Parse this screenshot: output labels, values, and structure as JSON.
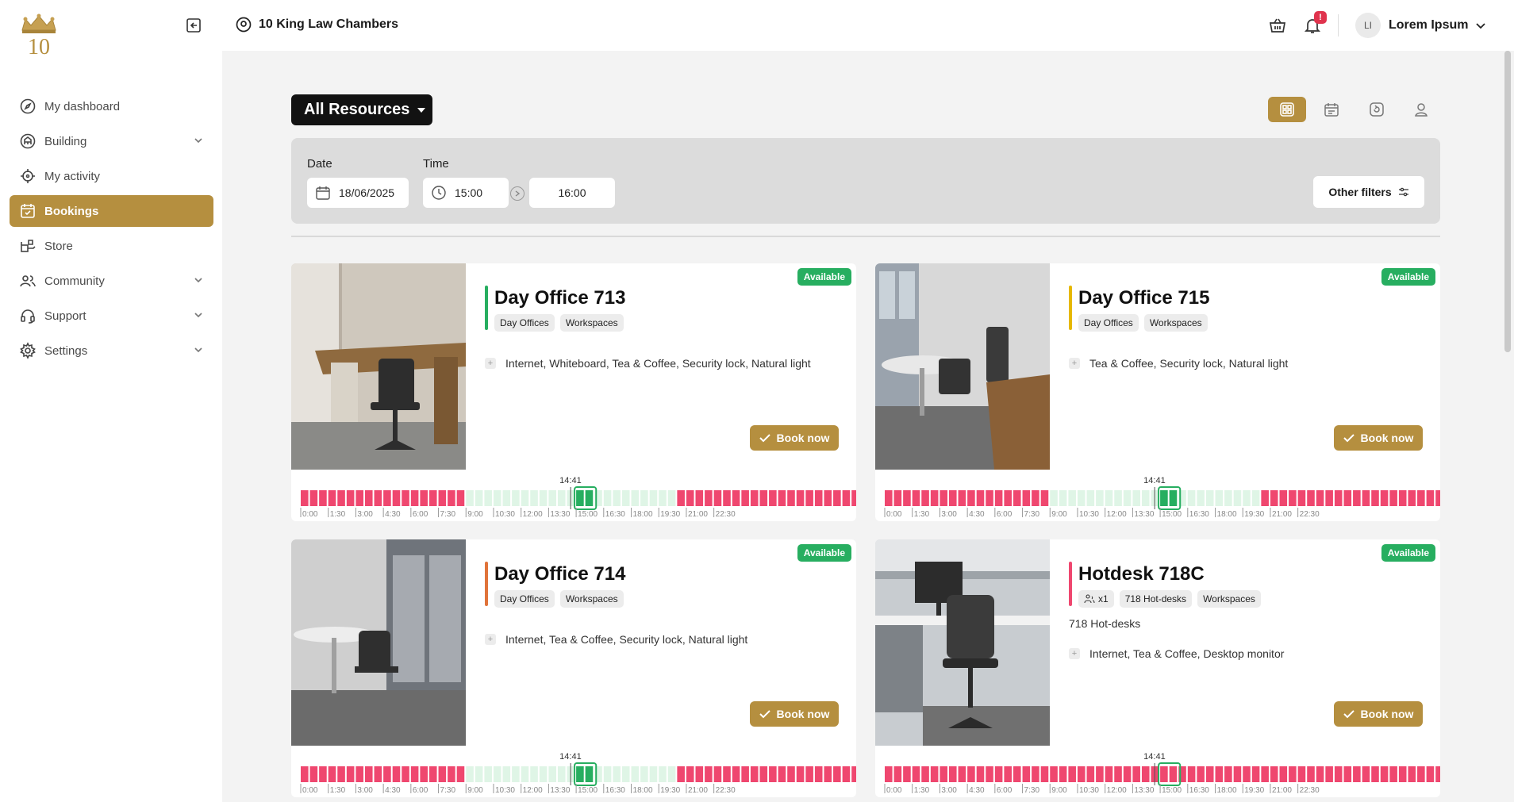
{
  "sidebar": {
    "items": [
      {
        "label": "My dashboard",
        "icon": "compass-icon",
        "has_chevron": false,
        "active": false
      },
      {
        "label": "Building",
        "icon": "building-icon",
        "has_chevron": true,
        "active": false
      },
      {
        "label": "My activity",
        "icon": "crosshair-icon",
        "has_chevron": false,
        "active": false
      },
      {
        "label": "Bookings",
        "icon": "calendar-check-icon",
        "has_chevron": false,
        "active": true
      },
      {
        "label": "Store",
        "icon": "store-icon",
        "has_chevron": false,
        "active": false
      },
      {
        "label": "Community",
        "icon": "users-icon",
        "has_chevron": true,
        "active": false
      },
      {
        "label": "Support",
        "icon": "headset-icon",
        "has_chevron": true,
        "active": false
      },
      {
        "label": "Settings",
        "icon": "gear-icon",
        "has_chevron": true,
        "active": false
      }
    ]
  },
  "header": {
    "location": "10 King Law Chambers",
    "notification_badge": "!",
    "avatar_initials": "LI",
    "user_name": "Lorem Ipsum"
  },
  "toolbar": {
    "resource_filter": "All Resources",
    "views": [
      "grid-view-icon",
      "calendar-view-icon",
      "timeline-view-icon",
      "person-view-icon"
    ],
    "active_view": 0
  },
  "filters": {
    "date_label": "Date",
    "date_value": "18/06/2025",
    "time_label": "Time",
    "time_start": "15:00",
    "time_end": "16:00",
    "other_filters": "Other filters"
  },
  "timeline_ticks": [
    "0:00",
    "1:30",
    "3:00",
    "4:30",
    "6:00",
    "7:30",
    "9:00",
    "10:30",
    "12:00",
    "13:30",
    "15:00",
    "16:30",
    "18:00",
    "19:30",
    "21:00",
    "22:30"
  ],
  "colors": {
    "gold": "#b58f3f",
    "booked": "#ef476f",
    "free": "#dff5e6",
    "selected": "#27ae60",
    "available_badge": "#27ae60"
  },
  "cards": [
    {
      "title": "Day Office 713",
      "accent": "#27ae60",
      "tags": [
        "Day Offices",
        "Workspaces"
      ],
      "seat_tag": "",
      "subtitle": "",
      "amenities": "Internet, Whiteboard, Tea & Coffee, Security lock, Natural light",
      "status": "Available",
      "book_label": "Book now",
      "now_label": "14:41",
      "photo": "desk",
      "slots": "bbbbbbbbbbbbbbbbbbfffffffffffffffffffffffbbbbbbbbbbbbbbbbbbbb"
    },
    {
      "title": "Day Office 715",
      "accent": "#e6b800",
      "tags": [
        "Day Offices",
        "Workspaces"
      ],
      "seat_tag": "",
      "subtitle": "",
      "amenities": "Tea & Coffee, Security lock, Natural light",
      "status": "Available",
      "book_label": "Book now",
      "now_label": "14:41",
      "photo": "round",
      "slots": "bbbbbbbbbbbbbbbbbbfffffffffffffffffffffffbbbbbbbbbbbbbbbbbbbb"
    },
    {
      "title": "Day Office 714",
      "accent": "#e0733a",
      "tags": [
        "Day Offices",
        "Workspaces"
      ],
      "seat_tag": "",
      "subtitle": "",
      "amenities": "Internet, Tea & Coffee, Security lock, Natural light",
      "status": "Available",
      "book_label": "Book now",
      "now_label": "14:41",
      "photo": "window",
      "slots": "bbbbbbbbbbbbbbbbbbfffffffffffffffffffffffbbbbbbbbbbbbbbbbbbbb"
    },
    {
      "title": "Hotdesk 718C",
      "accent": "#ef476f",
      "tags": [
        "718 Hot-desks",
        "Workspaces"
      ],
      "seat_tag": "x1",
      "subtitle": "718 Hot-desks",
      "amenities": "Internet, Tea & Coffee, Desktop monitor",
      "status": "Available",
      "book_label": "Book now",
      "now_label": "14:41",
      "photo": "cubicle",
      "slots": "bbbbbbbbbbbbbbbbbbbbbbbbbbbbbbbbbbbbbbbbbbbbbbbbbbbbbbbbbbbbb"
    }
  ]
}
